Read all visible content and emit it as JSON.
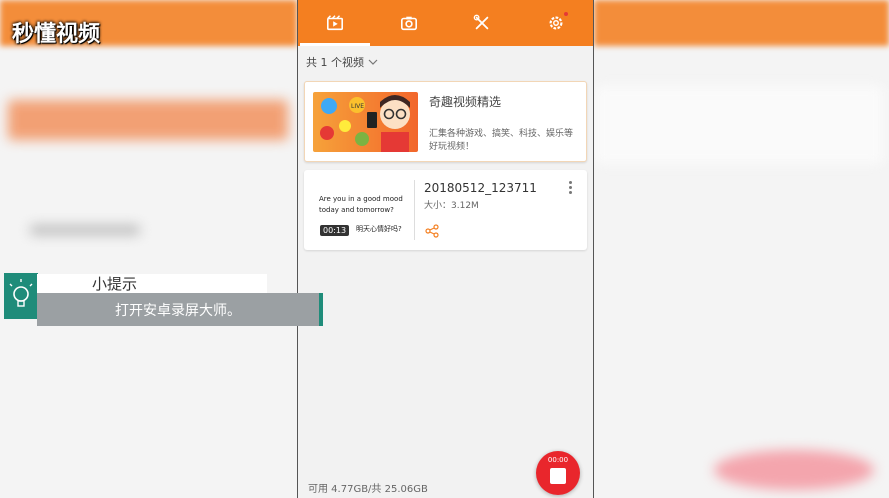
{
  "logo": {
    "text": "秒懂视频"
  },
  "tabs": [
    {
      "icon": "video-icon",
      "active": true
    },
    {
      "icon": "camera-icon",
      "active": false
    },
    {
      "icon": "tools-icon",
      "active": false
    },
    {
      "icon": "settings-icon",
      "active": false,
      "badge": true
    }
  ],
  "list_header": {
    "count_label": "共 1 个视频"
  },
  "promo_card": {
    "title": "奇趣视频精选",
    "description": "汇集各种游戏、搞笑、科技、娱乐等好玩视频！",
    "image_text": "LIVE"
  },
  "video_card": {
    "thumb_line1": "Are you in a good mood",
    "thumb_line2": "today and tomorrow?",
    "thumb_caption": "明天心情好吗?",
    "duration": "00:13",
    "name": "20180512_123711",
    "size": "大小：3.12M"
  },
  "storage": {
    "text": "可用 4.77GB/共 25.06GB"
  },
  "record_button": {
    "time": "00:00"
  },
  "tip": {
    "title": "小提示",
    "text": "打开安卓录屏大师。"
  },
  "colors": {
    "accent": "#f47f20",
    "record": "#e9262c",
    "tip_accent": "#1f8c7a"
  }
}
